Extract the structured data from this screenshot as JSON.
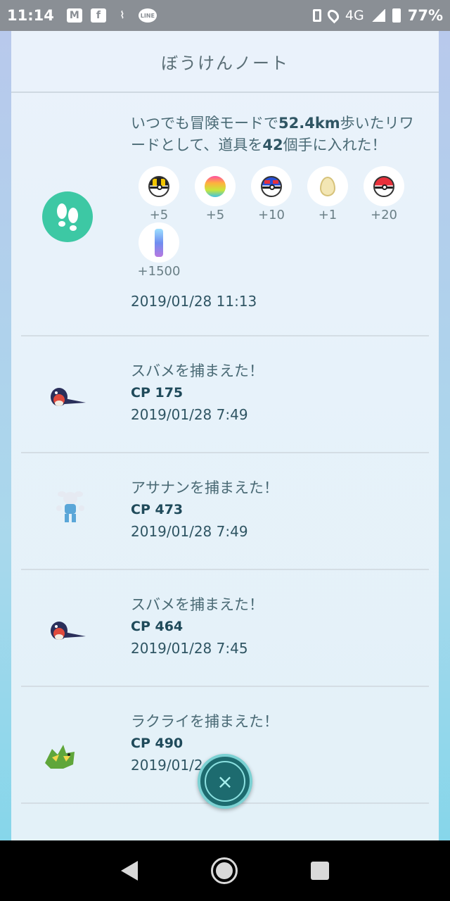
{
  "statusbar": {
    "time": "11:14",
    "network": "4G",
    "battery": "77%",
    "left_icons": [
      "gmail-icon",
      "facebook-icon",
      "broom-icon",
      "line-icon"
    ],
    "right_icons": [
      "vibrate-icon",
      "location-icon",
      "signal-icon",
      "battery-icon"
    ]
  },
  "header": {
    "title": "ぼうけんノート"
  },
  "entries": [
    {
      "desc_parts": [
        "いつでも冒険モードで",
        "52.4km",
        "歩いたリワードとして、道具を",
        "42",
        "個手に入れた！"
      ],
      "items": [
        {
          "icon": "ultra-ball-icon",
          "count": "+5"
        },
        {
          "icon": "razz-berry-rainbow-icon",
          "count": "+5"
        },
        {
          "icon": "great-ball-icon",
          "count": "+10"
        },
        {
          "icon": "egg-icon",
          "count": "+1"
        },
        {
          "icon": "poke-ball-icon",
          "count": "+20"
        },
        {
          "icon": "stardust-icon",
          "count": "+1500"
        }
      ],
      "date": "2019/01/28 11:13"
    },
    {
      "title": "スバメを捕まえた！",
      "cp": "CP 175",
      "date": "2019/01/28 7:49"
    },
    {
      "title": "アサナンを捕まえた！",
      "cp": "CP 473",
      "date": "2019/01/28 7:49"
    },
    {
      "title": "スバメを捕まえた！",
      "cp": "CP 464",
      "date": "2019/01/28 7:45"
    },
    {
      "title": "ラクライを捕まえた！",
      "cp": "CP 490",
      "date": "2019/01/2"
    }
  ],
  "close_label": "×",
  "colors": {
    "accent": "#3dc8a4",
    "close": "#1d6b6f"
  }
}
